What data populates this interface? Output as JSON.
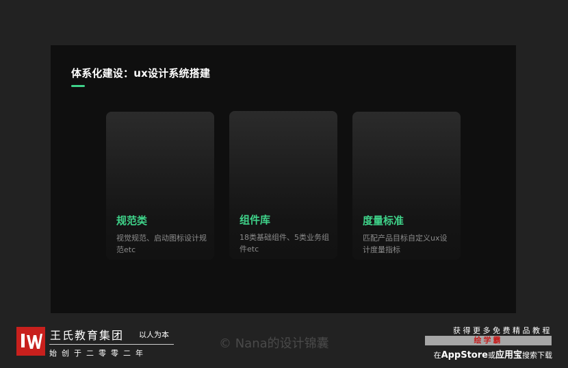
{
  "slide": {
    "title": "体系化建设：ux设计系统搭建",
    "accent_color": "#3fd38a",
    "cards": [
      {
        "title": "规范类",
        "description": "视觉规范、启动图标设计规范etc"
      },
      {
        "title": "组件库",
        "description": "18类基础组件、5类业务组件etc"
      },
      {
        "title": "度量标准",
        "description": "匹配产品目标自定义ux设计度量指标"
      }
    ]
  },
  "footer": {
    "brand_name": "王氏教育集团",
    "brand_slogan": "以人为本",
    "brand_motto": "始创于二零零二年",
    "logo_color": "#c8201d",
    "watermark": "© Nana的设计锦囊",
    "promo_top": "获得更多免费精品教程",
    "promo_app": "绘学霸",
    "promo_bottom_prefix": "在",
    "promo_bottom_store": "AppStore",
    "promo_bottom_or": "或",
    "promo_bottom_store2": "应用宝",
    "promo_bottom_suffix": "搜索下载"
  }
}
